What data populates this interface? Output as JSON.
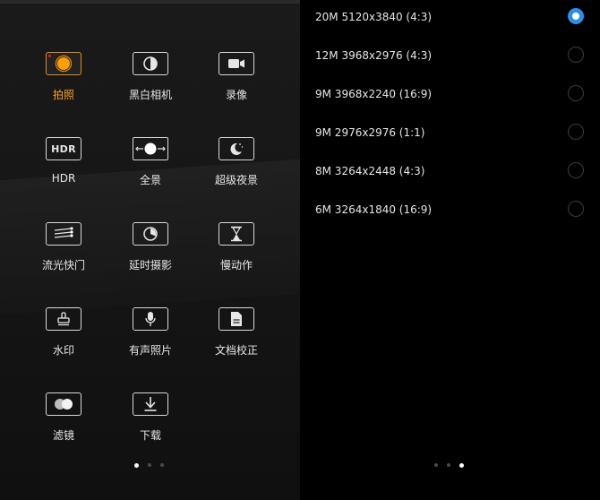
{
  "modes": [
    {
      "label": "拍照",
      "icon": "photo-icon",
      "active": true
    },
    {
      "label": "黑白相机",
      "icon": "monochrome-icon"
    },
    {
      "label": "录像",
      "icon": "video-icon"
    },
    {
      "label": "HDR",
      "icon": "hdr-icon"
    },
    {
      "label": "全景",
      "icon": "panorama-icon"
    },
    {
      "label": "超级夜景",
      "icon": "night-icon"
    },
    {
      "label": "流光快门",
      "icon": "light-painting-icon"
    },
    {
      "label": "延时摄影",
      "icon": "time-lapse-icon"
    },
    {
      "label": "慢动作",
      "icon": "slow-motion-icon"
    },
    {
      "label": "水印",
      "icon": "watermark-icon"
    },
    {
      "label": "有声照片",
      "icon": "audio-photo-icon"
    },
    {
      "label": "文档校正",
      "icon": "document-icon"
    },
    {
      "label": "滤镜",
      "icon": "filter-icon"
    },
    {
      "label": "下载",
      "icon": "download-icon"
    }
  ],
  "hdr_icon_text": "HDR",
  "resolutions": [
    {
      "label": "20M 5120x3840 (4:3)",
      "selected": true
    },
    {
      "label": "12M 3968x2976 (4:3)",
      "selected": false
    },
    {
      "label": "9M 3968x2240 (16:9)",
      "selected": false
    },
    {
      "label": "9M 2976x2976 (1:1)",
      "selected": false
    },
    {
      "label": "8M 3264x2448 (4:3)",
      "selected": false
    },
    {
      "label": "6M 3264x1840 (16:9)",
      "selected": false
    }
  ],
  "left_page_indicator": {
    "count": 3,
    "active": 0
  },
  "right_page_indicator": {
    "count": 3,
    "active": 2
  },
  "colors": {
    "accent": "#ffa31a",
    "radio_selected": "#2e8de8"
  }
}
